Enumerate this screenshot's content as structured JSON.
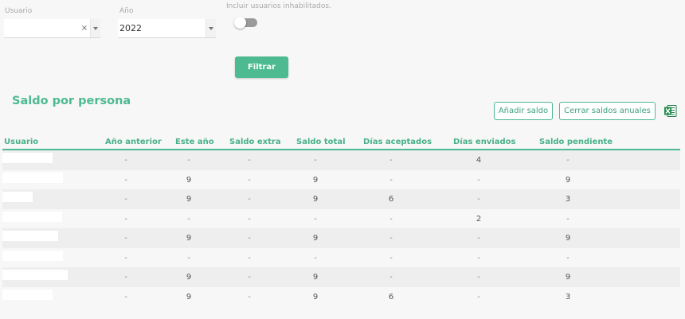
{
  "filters": {
    "usuario_label": "Usuario",
    "usuario_value": "",
    "clear_glyph": "×",
    "ano_label": "Año",
    "ano_value": "2022",
    "toggle_label": "Incluir usuarios inhabilitados.",
    "toggle_on": false,
    "filter_button": "Filtrar"
  },
  "section": {
    "title": "Saldo por persona",
    "add_button": "Añadir saldo",
    "close_button": "Cerrar saldos anuales",
    "export_icon": "excel-icon"
  },
  "colors": {
    "accent": "#4dba91",
    "row_alt": "#eeeeee"
  },
  "table": {
    "headers": [
      "Usuario",
      "Año anterior",
      "Este año",
      "Saldo extra",
      "Saldo total",
      "Días aceptados",
      "Días enviados",
      "Saldo pendiente"
    ],
    "rows": [
      [
        "",
        "-",
        "-",
        "-",
        "-",
        "-",
        "4",
        "-"
      ],
      [
        "",
        "-",
        "9",
        "-",
        "9",
        "-",
        "-",
        "9"
      ],
      [
        "",
        "-",
        "9",
        "-",
        "9",
        "6",
        "-",
        "3"
      ],
      [
        "",
        "-",
        "-",
        "-",
        "-",
        "-",
        "2",
        "-"
      ],
      [
        "",
        "-",
        "9",
        "-",
        "9",
        "-",
        "-",
        "9"
      ],
      [
        "",
        "-",
        "-",
        "-",
        "-",
        "-",
        "-",
        "-"
      ],
      [
        "",
        "-",
        "9",
        "-",
        "9",
        "-",
        "-",
        "9"
      ],
      [
        "",
        "-",
        "9",
        "-",
        "9",
        "6",
        "-",
        "3"
      ]
    ]
  }
}
